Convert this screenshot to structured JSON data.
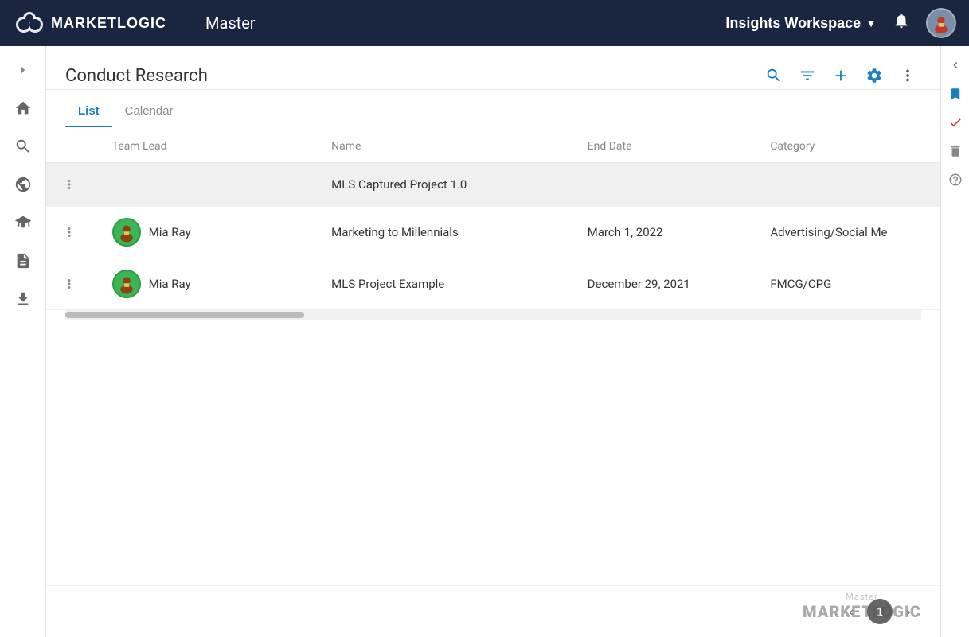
{
  "topNav": {
    "appName": "MARKETLOGIC",
    "instanceName": "Master",
    "workspace": "Insights Workspace",
    "workspaceChevron": "▼"
  },
  "leftSidebar": {
    "expandIcon": "›",
    "items": [
      {
        "id": "home",
        "icon": "⌂",
        "label": "Home"
      },
      {
        "id": "search",
        "icon": "🔍",
        "label": "Search"
      },
      {
        "id": "globe",
        "icon": "🌐",
        "label": "Globe"
      },
      {
        "id": "learn",
        "icon": "🎓",
        "label": "Learn"
      },
      {
        "id": "reports",
        "icon": "📋",
        "label": "Reports"
      },
      {
        "id": "upload",
        "icon": "⬆",
        "label": "Upload"
      }
    ]
  },
  "rightSidebar": {
    "items": [
      {
        "id": "collapse",
        "icon": "›",
        "label": "Collapse"
      },
      {
        "id": "bookmark",
        "icon": "🔖",
        "label": "Bookmark"
      },
      {
        "id": "tasks",
        "icon": "✅",
        "label": "Tasks",
        "accent": true
      },
      {
        "id": "filter2",
        "icon": "🗑",
        "label": "Filter"
      },
      {
        "id": "help",
        "icon": "❓",
        "label": "Help"
      }
    ]
  },
  "page": {
    "title": "Conduct Research",
    "tabs": [
      {
        "id": "list",
        "label": "List",
        "active": true
      },
      {
        "id": "calendar",
        "label": "Calendar",
        "active": false
      }
    ],
    "headerActions": {
      "search": "search",
      "filter": "filter",
      "add": "add",
      "settings": "settings",
      "more": "more"
    }
  },
  "table": {
    "columns": [
      {
        "id": "menu",
        "label": ""
      },
      {
        "id": "teamLead",
        "label": "Team Lead"
      },
      {
        "id": "name",
        "label": "Name"
      },
      {
        "id": "endDate",
        "label": "End Date"
      },
      {
        "id": "category",
        "label": "Category"
      }
    ],
    "rows": [
      {
        "id": 1,
        "highlighted": true,
        "teamLead": null,
        "teamLeadName": "",
        "name": "MLS Captured Project 1.0",
        "endDate": "",
        "category": ""
      },
      {
        "id": 2,
        "highlighted": false,
        "teamLead": "mia",
        "teamLeadName": "Mia Ray",
        "name": "Marketing to Millennials",
        "endDate": "March 1, 2022",
        "category": "Advertising/Social Me"
      },
      {
        "id": 3,
        "highlighted": false,
        "teamLead": "mia",
        "teamLeadName": "Mia Ray",
        "name": "MLS Project Example",
        "endDate": "December 29, 2021",
        "category": "FMCG/CPG"
      }
    ]
  },
  "pagination": {
    "prevLabel": "‹",
    "nextLabel": "›",
    "currentPage": "1"
  },
  "watermark": {
    "sub": "Master",
    "brand": "MARKETLOGIC"
  }
}
